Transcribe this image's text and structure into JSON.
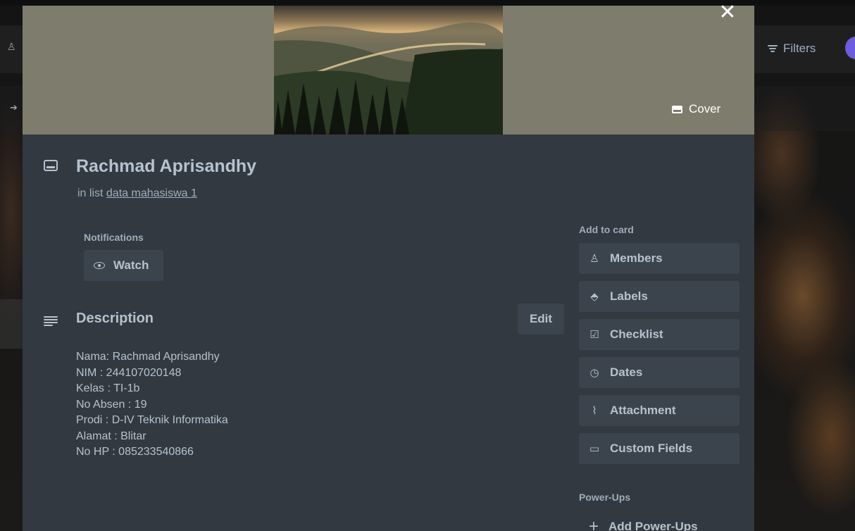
{
  "board": {
    "filters_label": "Filters"
  },
  "card": {
    "cover_label": "Cover",
    "close_glyph": "✕",
    "title": "Rachmad Aprisandhy",
    "in_list_prefix": "in list ",
    "list_name": "data mahasiswa 1"
  },
  "notifications": {
    "label": "Notifications",
    "watch_label": "Watch"
  },
  "description": {
    "title": "Description",
    "edit_label": "Edit",
    "lines": [
      "Nama: Rachmad Aprisandhy",
      "NIM : 244107020148",
      "Kelas : TI-1b",
      "No Absen : 19",
      "Prodi : D-IV Teknik Informatika",
      "Alamat : Blitar",
      "No HP : 085233540866"
    ]
  },
  "sidebar": {
    "add_to_card_label": "Add to card",
    "buttons": [
      {
        "label": "Members",
        "icon": "person-icon",
        "glyph": "♙"
      },
      {
        "label": "Labels",
        "icon": "tag-icon",
        "glyph": "⬘"
      },
      {
        "label": "Checklist",
        "icon": "checkbox-icon",
        "glyph": "☑"
      },
      {
        "label": "Dates",
        "icon": "clock-icon",
        "glyph": "◷"
      },
      {
        "label": "Attachment",
        "icon": "paperclip-icon",
        "glyph": "⌇"
      },
      {
        "label": "Custom Fields",
        "icon": "custom-fields-icon",
        "glyph": "▭"
      }
    ],
    "power_ups_label": "Power-Ups",
    "add_power_ups_label": "Add Power-Ups"
  },
  "colors": {
    "modal_bg": "#323940",
    "button_bg": "#3b444c",
    "text": "#b6c2cf",
    "cover_bg": "#7e7c6c"
  }
}
